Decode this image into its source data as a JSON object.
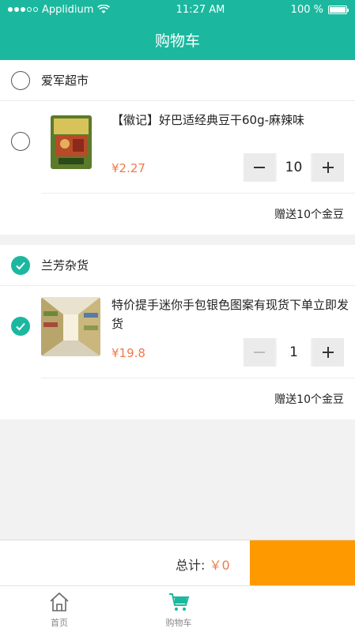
{
  "status_bar": {
    "carrier": "Applidium",
    "time": "11:27 AM",
    "battery": "100 %"
  },
  "header": {
    "title": "购物车"
  },
  "shops": [
    {
      "name": "爱军超市",
      "checked": false,
      "item": {
        "title": "【徽记】好巴适经典豆干60g-麻辣味",
        "price": "¥2.27",
        "quantity": "10",
        "checked": false
      },
      "bonus": "赠送10个金豆"
    },
    {
      "name": "兰芳杂货",
      "checked": true,
      "item": {
        "title": "特价提手迷你手包银色图案有现货下单立即发货",
        "price": "¥19.8",
        "quantity": "1",
        "checked": true
      },
      "bonus": "赠送10个金豆"
    }
  ],
  "footer": {
    "total_label": "总计:",
    "total_amount": "￥0",
    "checkout_label": ""
  },
  "tabbar": {
    "items": [
      {
        "label": "首页",
        "icon": "home-icon"
      },
      {
        "label": "购物车",
        "icon": "cart-icon"
      }
    ]
  },
  "colors": {
    "accent": "#1bb89f",
    "price": "#f07a4b",
    "checkout": "#ff9900"
  }
}
